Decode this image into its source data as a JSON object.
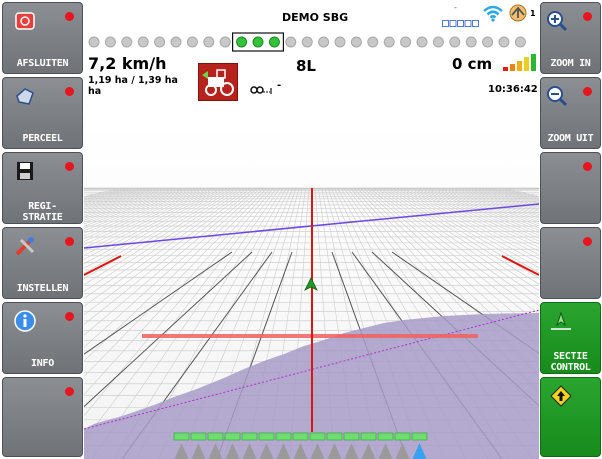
{
  "left_buttons": [
    {
      "label": "AFSLUITEN",
      "icon": "exit-icon"
    },
    {
      "label": "PERCEEL",
      "icon": "field-icon"
    },
    {
      "label_line1": "REGI-",
      "label_line2": "STRATIE",
      "icon": "save-icon"
    },
    {
      "label": "INSTELLEN",
      "icon": "tools-icon"
    },
    {
      "label": "INFO",
      "icon": "info-icon"
    },
    {
      "label": "",
      "icon": ""
    }
  ],
  "right_buttons": [
    {
      "label": "ZOOM IN",
      "icon": "zoom-in-icon"
    },
    {
      "label": "ZOOM UIT",
      "icon": "zoom-out-icon"
    },
    {
      "label": "",
      "icon": ""
    },
    {
      "label": "",
      "icon": ""
    },
    {
      "label_line1": "SECTIE",
      "label_line2": "CONTROL",
      "icon": "section-control-icon"
    },
    {
      "label": "",
      "icon": "up-arrow-icon"
    }
  ],
  "header": {
    "title": "DEMO SBG",
    "speed": "7,2 km/h",
    "area": "1,19 ha / 1,39 ha",
    "area_wrap": "ha",
    "guidance_line": "8L",
    "offset": "0 cm",
    "time": "10:36:42",
    "implement_value": "-",
    "satellite_count": "1",
    "signal_dash": "-"
  },
  "colors": {
    "accent_red": "#e8141e",
    "guide_line": "#e0140f",
    "coverage": "#a89cc8",
    "section_on": "#6edc6e"
  },
  "led_bar": {
    "total": 27,
    "active": [
      9,
      10,
      11
    ]
  }
}
